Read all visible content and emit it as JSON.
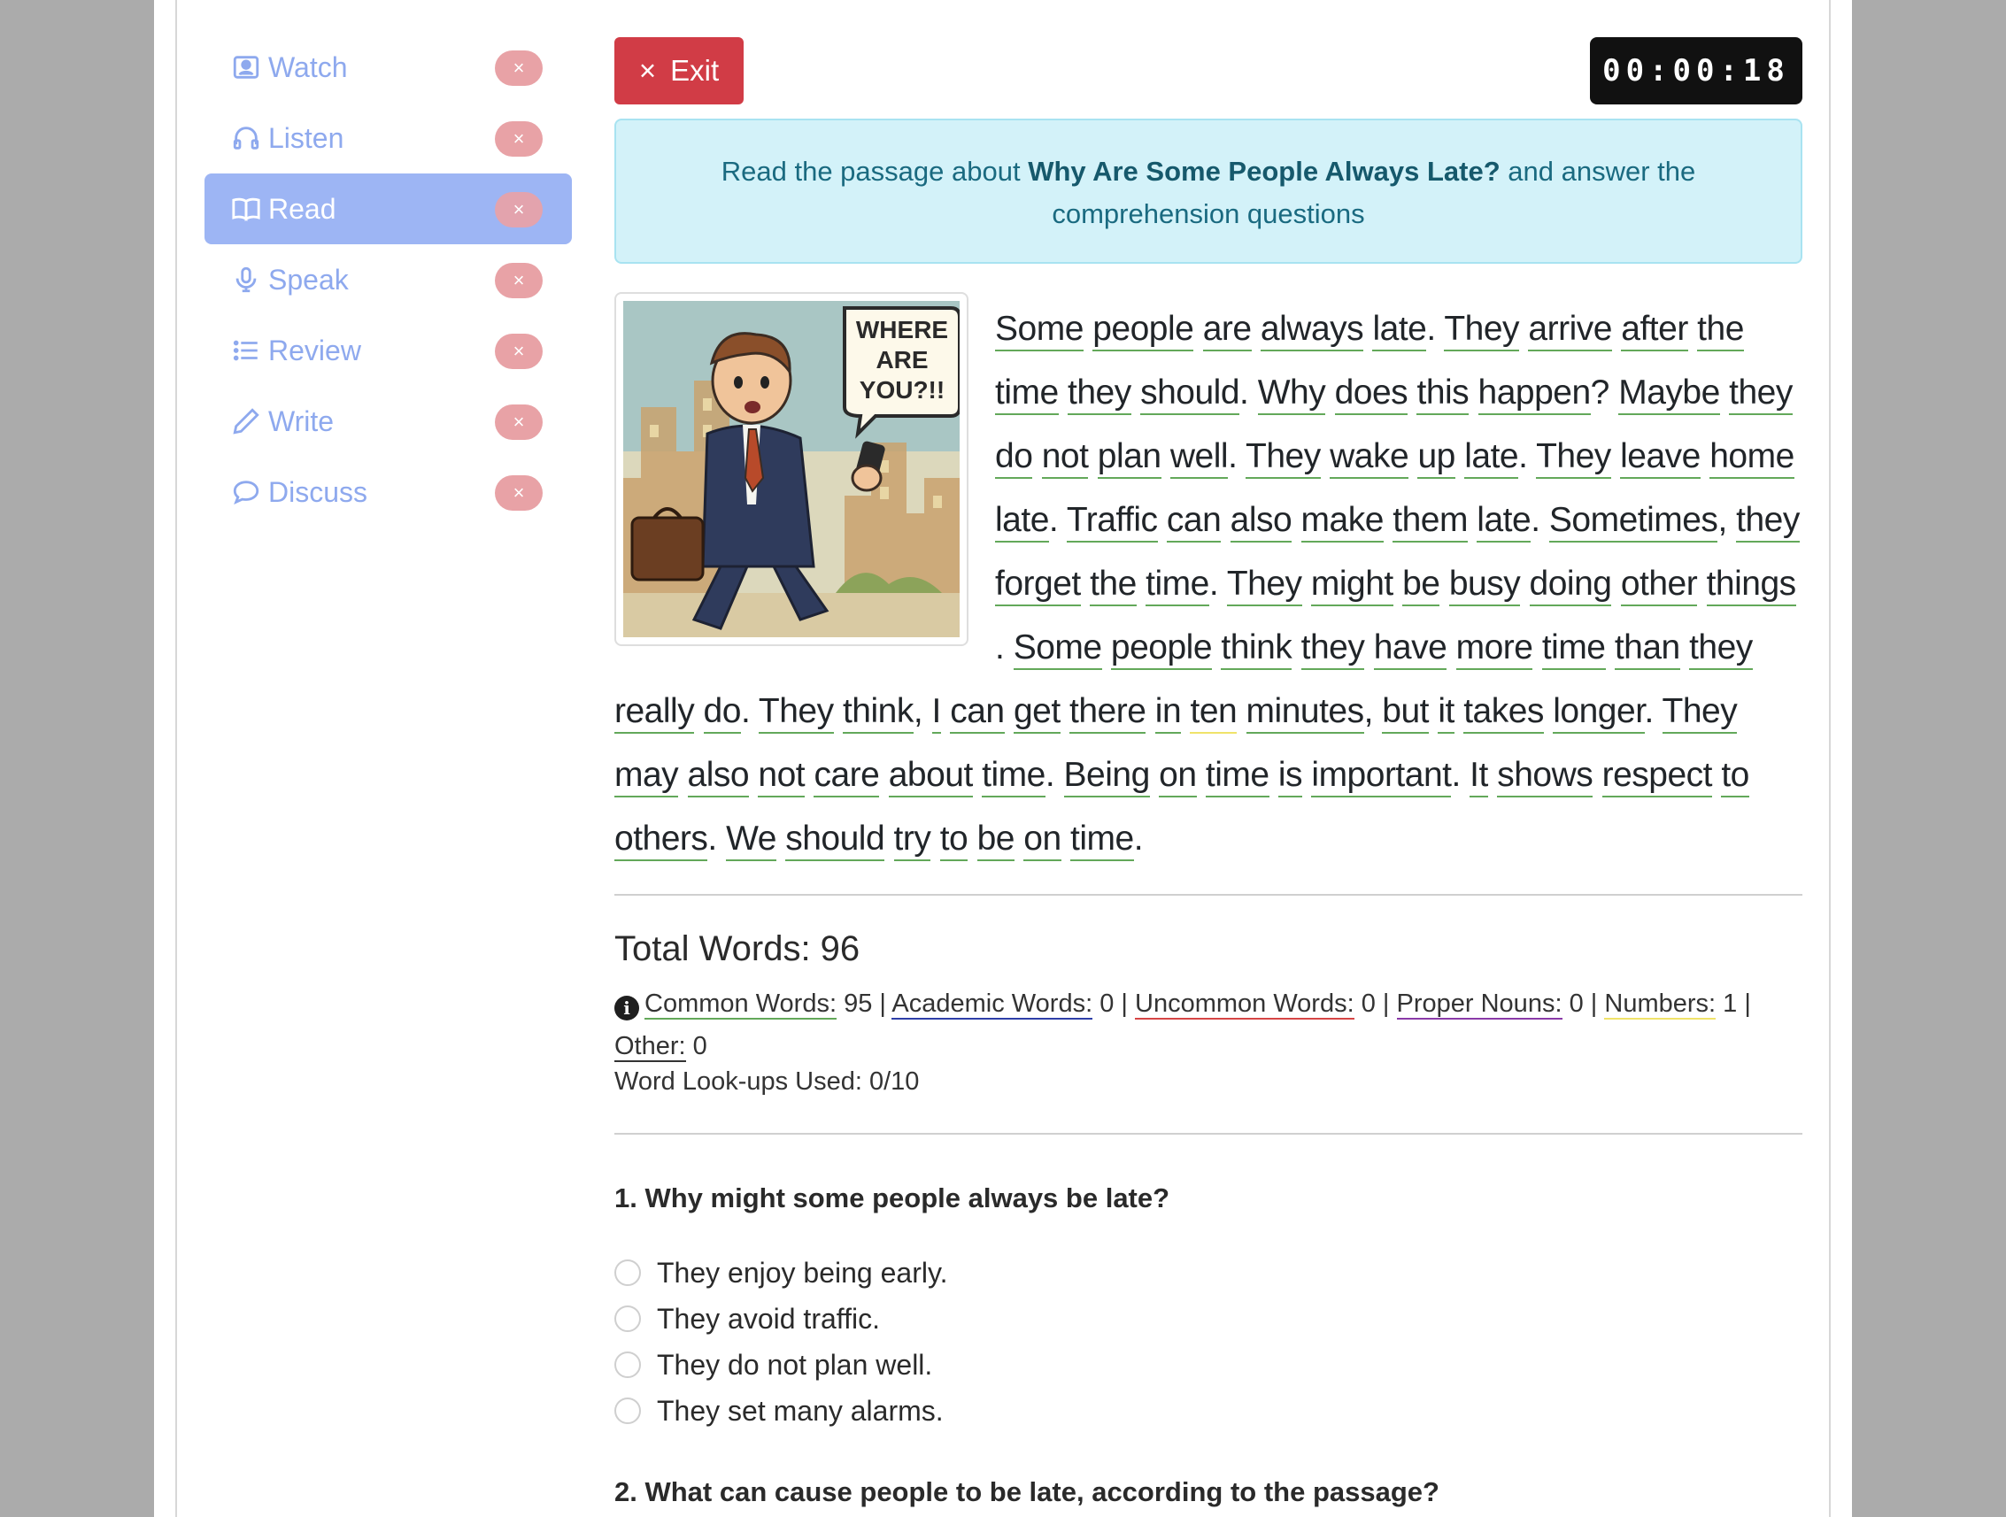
{
  "sidebar": {
    "items": [
      {
        "label": "Watch",
        "icon": "person-video-icon",
        "close": "×"
      },
      {
        "label": "Listen",
        "icon": "headphones-icon",
        "close": "×"
      },
      {
        "label": "Read",
        "icon": "book-icon",
        "close": "×",
        "active": true
      },
      {
        "label": "Speak",
        "icon": "microphone-icon",
        "close": "×"
      },
      {
        "label": "Review",
        "icon": "list-icon",
        "close": "×"
      },
      {
        "label": "Write",
        "icon": "pencil-icon",
        "close": "×"
      },
      {
        "label": "Discuss",
        "icon": "chat-bubble-icon",
        "close": "×"
      }
    ]
  },
  "toolbar": {
    "exit_icon": "×",
    "exit_label": "Exit",
    "timer": "00:00:18"
  },
  "instruction": {
    "prefix": "Read the passage about ",
    "title": "Why Are Some People Always Late?",
    "suffix": " and answer the comprehension questions"
  },
  "illustration": {
    "bubble_line1": "WHERE",
    "bubble_line2": "ARE",
    "bubble_line3": "YOU?!!"
  },
  "passage": {
    "text": "Some people are always late. They arrive after the time they should. Why does this happen? Maybe they do not plan well. They wake up late. They leave home late. Traffic can also make them late. Sometimes, they forget the time. They might be busy doing other things . Some people think they have more time than they really do. They think, I can get there in ten minutes, but it takes longer. They may also not care about time. Being on time is important. It shows respect to others. We should try to be on time.",
    "number_words": [
      "ten"
    ]
  },
  "stats": {
    "total_label": "Total Words: 96",
    "common_label": "Common Words:",
    "common_value": "95",
    "academic_label": "Academic Words:",
    "academic_value": "0",
    "uncommon_label": "Uncommon Words:",
    "uncommon_value": "0",
    "proper_label": "Proper Nouns:",
    "proper_value": "0",
    "numbers_label": "Numbers:",
    "numbers_value": "1",
    "other_label": "Other:",
    "other_value": "0",
    "lookups": "Word Look-ups Used: 0/10",
    "colors": {
      "common": "#63a85a",
      "academic": "#2e3fa8",
      "uncommon": "#d64545",
      "proper": "#8a3aa8",
      "numbers": "#f0e36a",
      "other": "#333333"
    }
  },
  "questions": [
    {
      "text": "1. Why might some people always be late?",
      "options": [
        "They enjoy being early.",
        "They avoid traffic.",
        "They do not plan well.",
        "They set many alarms."
      ]
    },
    {
      "text": "2. What can cause people to be late, according to the passage?"
    }
  ]
}
